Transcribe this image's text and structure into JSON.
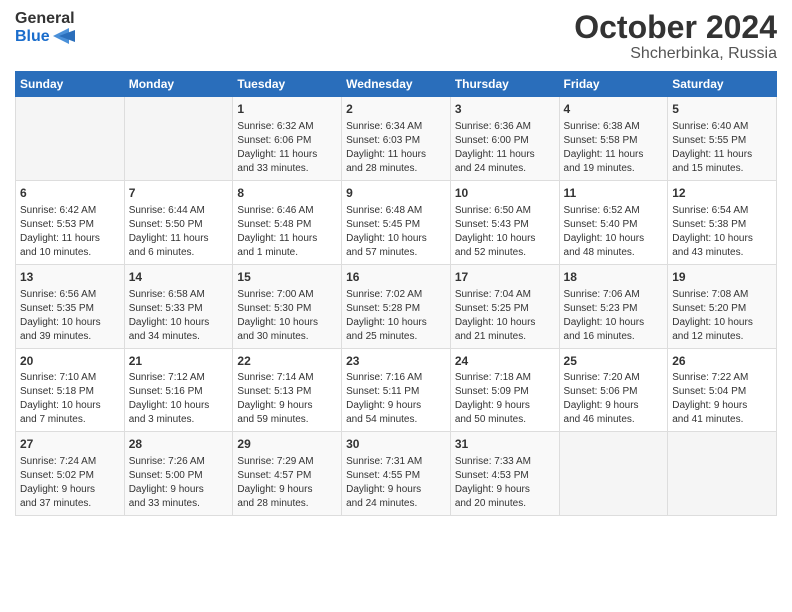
{
  "header": {
    "logo_line1": "General",
    "logo_line2": "Blue",
    "month_title": "October 2024",
    "subtitle": "Shcherbinka, Russia"
  },
  "weekdays": [
    "Sunday",
    "Monday",
    "Tuesday",
    "Wednesday",
    "Thursday",
    "Friday",
    "Saturday"
  ],
  "weeks": [
    [
      {
        "day": "",
        "info": ""
      },
      {
        "day": "",
        "info": ""
      },
      {
        "day": "1",
        "info": "Sunrise: 6:32 AM\nSunset: 6:06 PM\nDaylight: 11 hours\nand 33 minutes."
      },
      {
        "day": "2",
        "info": "Sunrise: 6:34 AM\nSunset: 6:03 PM\nDaylight: 11 hours\nand 28 minutes."
      },
      {
        "day": "3",
        "info": "Sunrise: 6:36 AM\nSunset: 6:00 PM\nDaylight: 11 hours\nand 24 minutes."
      },
      {
        "day": "4",
        "info": "Sunrise: 6:38 AM\nSunset: 5:58 PM\nDaylight: 11 hours\nand 19 minutes."
      },
      {
        "day": "5",
        "info": "Sunrise: 6:40 AM\nSunset: 5:55 PM\nDaylight: 11 hours\nand 15 minutes."
      }
    ],
    [
      {
        "day": "6",
        "info": "Sunrise: 6:42 AM\nSunset: 5:53 PM\nDaylight: 11 hours\nand 10 minutes."
      },
      {
        "day": "7",
        "info": "Sunrise: 6:44 AM\nSunset: 5:50 PM\nDaylight: 11 hours\nand 6 minutes."
      },
      {
        "day": "8",
        "info": "Sunrise: 6:46 AM\nSunset: 5:48 PM\nDaylight: 11 hours\nand 1 minute."
      },
      {
        "day": "9",
        "info": "Sunrise: 6:48 AM\nSunset: 5:45 PM\nDaylight: 10 hours\nand 57 minutes."
      },
      {
        "day": "10",
        "info": "Sunrise: 6:50 AM\nSunset: 5:43 PM\nDaylight: 10 hours\nand 52 minutes."
      },
      {
        "day": "11",
        "info": "Sunrise: 6:52 AM\nSunset: 5:40 PM\nDaylight: 10 hours\nand 48 minutes."
      },
      {
        "day": "12",
        "info": "Sunrise: 6:54 AM\nSunset: 5:38 PM\nDaylight: 10 hours\nand 43 minutes."
      }
    ],
    [
      {
        "day": "13",
        "info": "Sunrise: 6:56 AM\nSunset: 5:35 PM\nDaylight: 10 hours\nand 39 minutes."
      },
      {
        "day": "14",
        "info": "Sunrise: 6:58 AM\nSunset: 5:33 PM\nDaylight: 10 hours\nand 34 minutes."
      },
      {
        "day": "15",
        "info": "Sunrise: 7:00 AM\nSunset: 5:30 PM\nDaylight: 10 hours\nand 30 minutes."
      },
      {
        "day": "16",
        "info": "Sunrise: 7:02 AM\nSunset: 5:28 PM\nDaylight: 10 hours\nand 25 minutes."
      },
      {
        "day": "17",
        "info": "Sunrise: 7:04 AM\nSunset: 5:25 PM\nDaylight: 10 hours\nand 21 minutes."
      },
      {
        "day": "18",
        "info": "Sunrise: 7:06 AM\nSunset: 5:23 PM\nDaylight: 10 hours\nand 16 minutes."
      },
      {
        "day": "19",
        "info": "Sunrise: 7:08 AM\nSunset: 5:20 PM\nDaylight: 10 hours\nand 12 minutes."
      }
    ],
    [
      {
        "day": "20",
        "info": "Sunrise: 7:10 AM\nSunset: 5:18 PM\nDaylight: 10 hours\nand 7 minutes."
      },
      {
        "day": "21",
        "info": "Sunrise: 7:12 AM\nSunset: 5:16 PM\nDaylight: 10 hours\nand 3 minutes."
      },
      {
        "day": "22",
        "info": "Sunrise: 7:14 AM\nSunset: 5:13 PM\nDaylight: 9 hours\nand 59 minutes."
      },
      {
        "day": "23",
        "info": "Sunrise: 7:16 AM\nSunset: 5:11 PM\nDaylight: 9 hours\nand 54 minutes."
      },
      {
        "day": "24",
        "info": "Sunrise: 7:18 AM\nSunset: 5:09 PM\nDaylight: 9 hours\nand 50 minutes."
      },
      {
        "day": "25",
        "info": "Sunrise: 7:20 AM\nSunset: 5:06 PM\nDaylight: 9 hours\nand 46 minutes."
      },
      {
        "day": "26",
        "info": "Sunrise: 7:22 AM\nSunset: 5:04 PM\nDaylight: 9 hours\nand 41 minutes."
      }
    ],
    [
      {
        "day": "27",
        "info": "Sunrise: 7:24 AM\nSunset: 5:02 PM\nDaylight: 9 hours\nand 37 minutes."
      },
      {
        "day": "28",
        "info": "Sunrise: 7:26 AM\nSunset: 5:00 PM\nDaylight: 9 hours\nand 33 minutes."
      },
      {
        "day": "29",
        "info": "Sunrise: 7:29 AM\nSunset: 4:57 PM\nDaylight: 9 hours\nand 28 minutes."
      },
      {
        "day": "30",
        "info": "Sunrise: 7:31 AM\nSunset: 4:55 PM\nDaylight: 9 hours\nand 24 minutes."
      },
      {
        "day": "31",
        "info": "Sunrise: 7:33 AM\nSunset: 4:53 PM\nDaylight: 9 hours\nand 20 minutes."
      },
      {
        "day": "",
        "info": ""
      },
      {
        "day": "",
        "info": ""
      }
    ]
  ]
}
